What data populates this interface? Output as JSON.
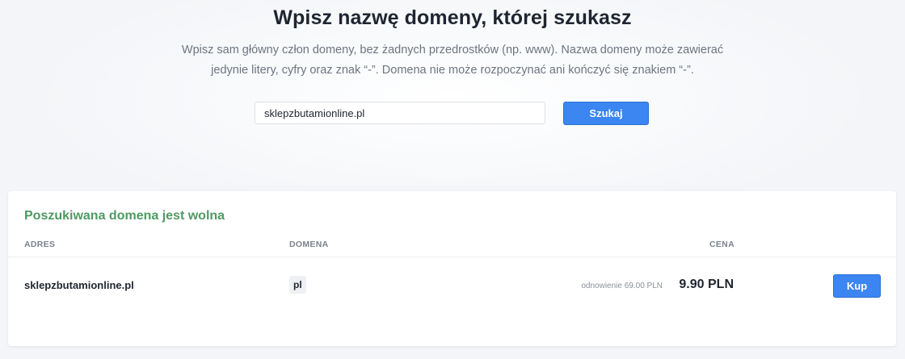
{
  "hero": {
    "title": "Wpisz nazwę domeny, której szukasz",
    "subtitle_line1": "Wpisz sam główny człon domeny, bez żadnych przedrostków (np. www). Nazwa domeny może zawierać",
    "subtitle_line2": "jedynie litery, cyfry oraz znak “-”. Domena nie może rozpoczynać ani kończyć się znakiem “-”."
  },
  "search": {
    "value": "sklepzbutamionline.pl",
    "button_label": "Szukaj"
  },
  "results": {
    "heading": "Poszukiwana domena jest wolna",
    "columns": {
      "address": "ADRES",
      "domain": "DOMENA",
      "price": "CENA"
    },
    "rows": [
      {
        "address": "sklepzbutamionline.pl",
        "domain": "pl",
        "renewal": "odnowienie 69.00 PLN",
        "price": "9.90 PLN",
        "buy_label": "Kup"
      }
    ]
  },
  "colors": {
    "accent": "#3b86f0",
    "success": "#4d9a62",
    "background": "#f3f5f8"
  }
}
